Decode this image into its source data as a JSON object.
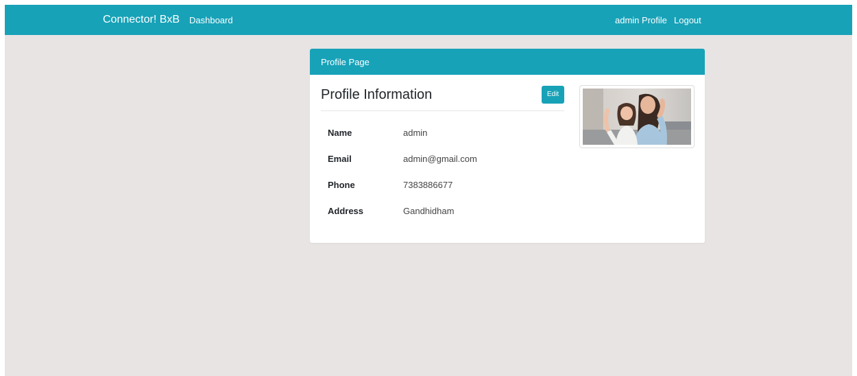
{
  "navbar": {
    "brand": "Connector! BxB",
    "dashboard_label": "Dashboard",
    "profile_label": "admin Profile",
    "logout_label": "Logout",
    "color": "#17a2b8"
  },
  "card": {
    "header_title": "Profile Page",
    "section_title": "Profile Information",
    "edit_label": "Edit",
    "fields": [
      {
        "label": "Name",
        "value": "admin"
      },
      {
        "label": "Email",
        "value": "admin@gmail.com"
      },
      {
        "label": "Phone",
        "value": "7383886677"
      },
      {
        "label": "Address",
        "value": "Gandhidham"
      }
    ],
    "photo_icon": "profile-photo"
  },
  "colors": {
    "accent": "#17a2b8",
    "background": "#e8e4e3",
    "card": "#ffffff"
  }
}
